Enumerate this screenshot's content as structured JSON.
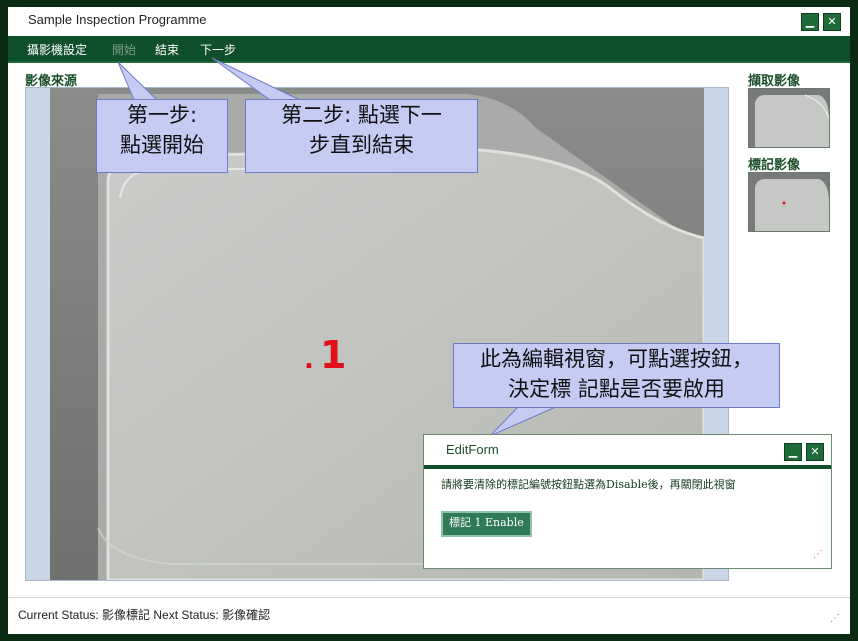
{
  "window": {
    "title": "Sample Inspection Programme"
  },
  "menu": [
    {
      "label": "攝影機設定",
      "enabled": true
    },
    {
      "label": "開始",
      "enabled": false
    },
    {
      "label": "結束",
      "enabled": true
    },
    {
      "label": "下一步",
      "enabled": true
    }
  ],
  "labels": {
    "source": "影像來源",
    "captured": "擷取影像",
    "marked": "標記影像"
  },
  "video": {
    "marker_dot": ".",
    "marker_number": "1"
  },
  "callouts": {
    "step1": [
      "第一步:",
      "點選開始"
    ],
    "step2": [
      "第二步: 點選下一",
      "步直到結束"
    ],
    "edit": [
      "此為編輯視窗，可點選按鈕，",
      "決定標 記點是否要啟用"
    ]
  },
  "editform": {
    "title": "EditForm",
    "message": "請將要清除的標記編號按鈕點選為Disable後，再關閉此視窗",
    "button_label": "標記 1 Enable"
  },
  "status": {
    "text": "Current Status: 影像標記   Next Status: 影像確認"
  },
  "colors": {
    "menu_bg": "#0f4f2a",
    "accent": "#1f6b3a",
    "marker": "#e0101a",
    "callout_bg": "#c5cbf2"
  }
}
